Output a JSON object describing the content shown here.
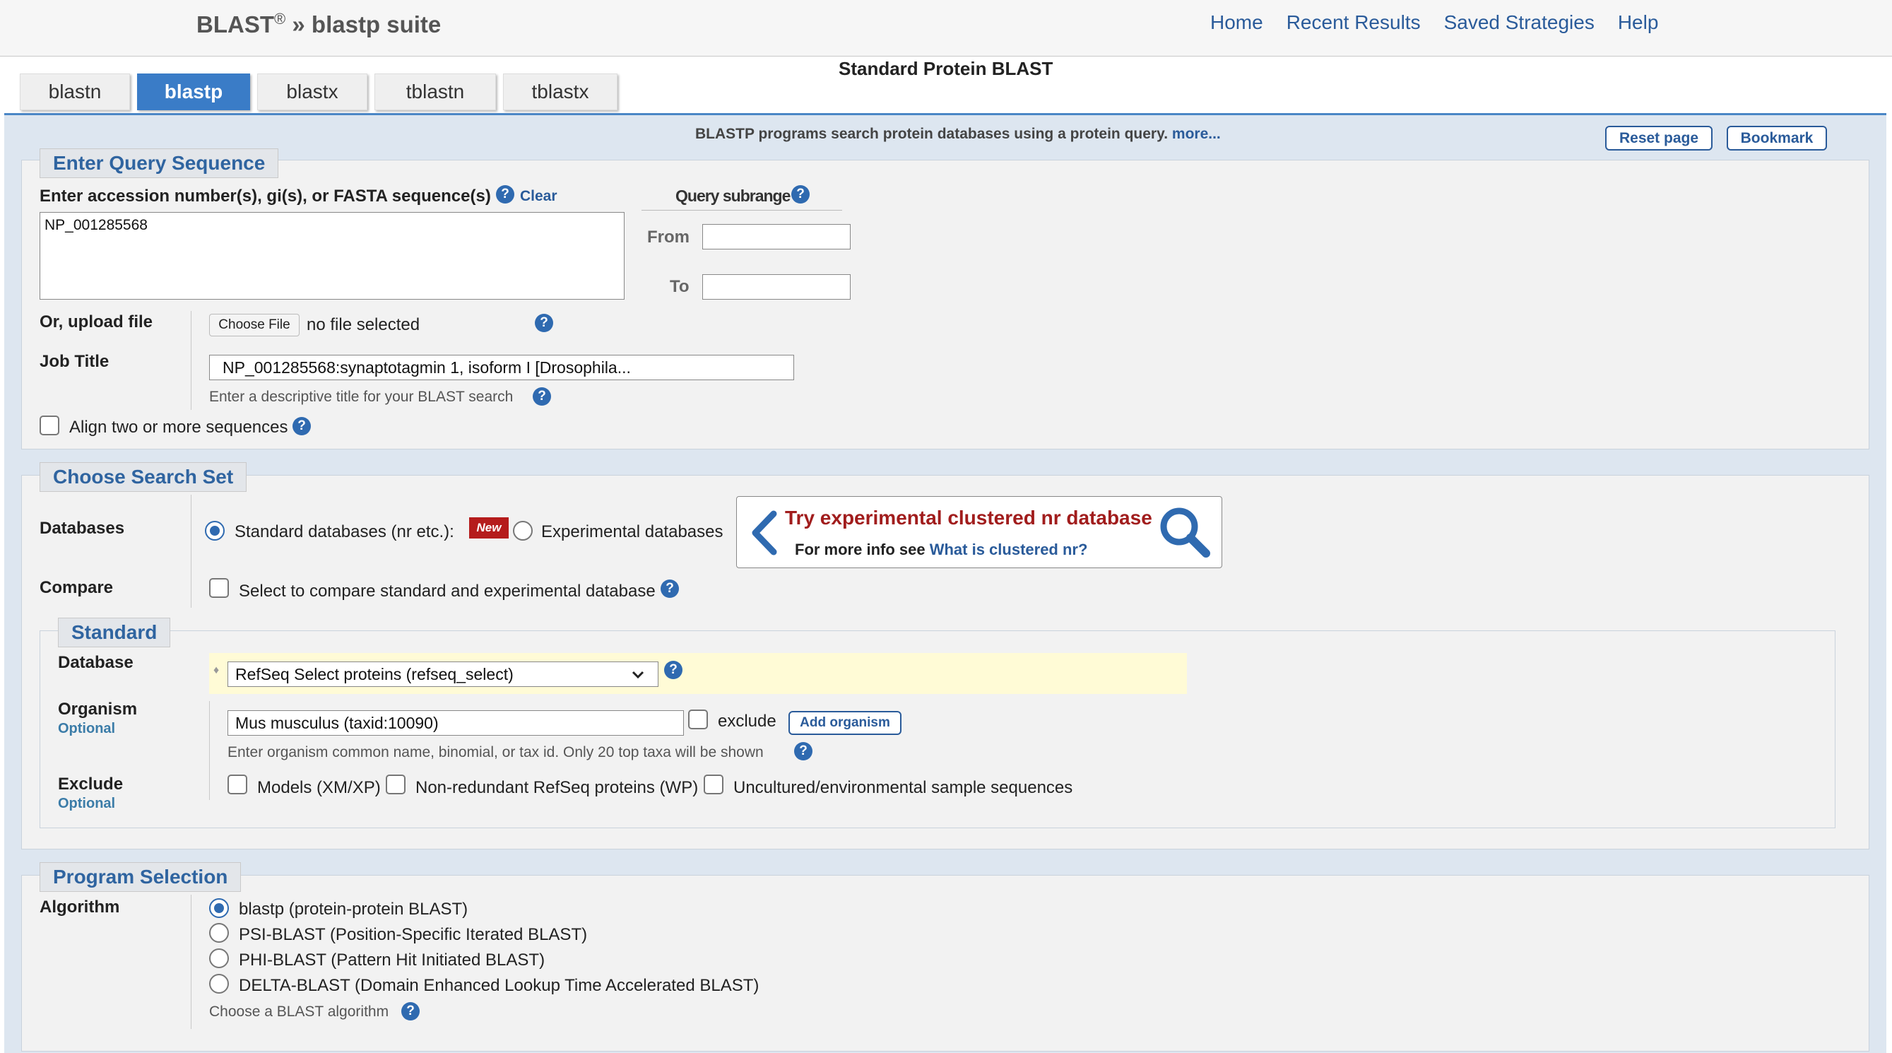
{
  "header": {
    "brand": "BLAST",
    "reg": "®",
    "suite": " » blastp suite"
  },
  "nav": [
    "Home",
    "Recent Results",
    "Saved Strategies",
    "Help"
  ],
  "page_title": "Standard Protein BLAST",
  "tabs": [
    "blastn",
    "blastp",
    "blastx",
    "tblastn",
    "tblastx"
  ],
  "active_tab": "blastp",
  "description": {
    "text": "BLASTP programs search protein databases using a protein query.",
    "more": "more..."
  },
  "buttons": {
    "reset": "Reset page",
    "bookmark": "Bookmark"
  },
  "query": {
    "legend": "Enter Query Sequence",
    "label": "Enter accession number(s), gi(s), or FASTA sequence(s)",
    "clear": "Clear",
    "value": "NP_001285568",
    "subrange": "Query subrange",
    "from": "From",
    "to": "To",
    "upload_label": "Or, upload file",
    "choose_file": "Choose File",
    "no_file": "no file selected",
    "job_label": "Job Title",
    "job_value": "NP_001285568:synaptotagmin 1, isoform I [Drosophila...",
    "job_hint": "Enter a descriptive title for your BLAST search",
    "align": "Align two or more sequences"
  },
  "search_set": {
    "legend": "Choose Search Set",
    "databases_label": "Databases",
    "standard_option": "Standard databases (nr etc.):",
    "new_badge": "New",
    "experimental_option": "Experimental databases",
    "promo_title": "Try experimental clustered nr database",
    "promo_sub": "For more info see",
    "promo_link": "What is clustered nr?",
    "compare_label": "Compare",
    "compare_text": "Select to compare standard and experimental database",
    "standard_legend": "Standard",
    "database_label": "Database",
    "database_value": "RefSeq Select proteins (refseq_select)",
    "organism_label": "Organism",
    "optional": "Optional",
    "organism_value": "Mus musculus (taxid:10090)",
    "exclude_word": "exclude",
    "add_organism": "Add organism",
    "organism_hint": "Enter organism common name, binomial, or tax id. Only 20 top taxa will be shown",
    "exclude_label": "Exclude",
    "exclude_opts": [
      "Models (XM/XP)",
      "Non-redundant RefSeq proteins (WP)",
      "Uncultured/environmental sample sequences"
    ]
  },
  "program": {
    "legend": "Program Selection",
    "algorithm_label": "Algorithm",
    "options": [
      "blastp (protein-protein BLAST)",
      "PSI-BLAST (Position-Specific Iterated BLAST)",
      "PHI-BLAST (Pattern Hit Initiated BLAST)",
      "DELTA-BLAST (Domain Enhanced Lookup Time Accelerated BLAST)"
    ],
    "hint": "Choose a BLAST algorithm"
  },
  "colors": {
    "accent": "#2f6ab0",
    "promo_red": "#a11d1d",
    "highlight": "#fffbd6"
  }
}
